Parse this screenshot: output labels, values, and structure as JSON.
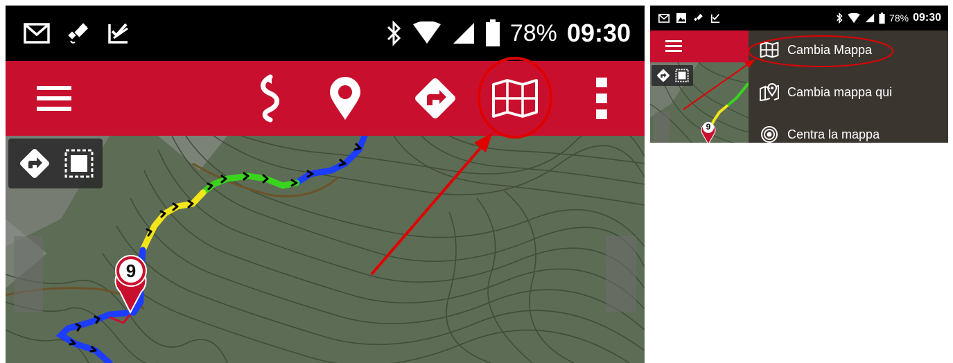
{
  "left_screen": {
    "status_bar": {
      "icons_left": [
        "gmail-icon",
        "satellite-icon",
        "checklist-icon"
      ],
      "icons_right": [
        "bluetooth-icon",
        "wifi-icon",
        "signal-icon",
        "battery-icon"
      ],
      "battery": "78%",
      "time": "09:30"
    },
    "toolbar": {
      "buttons": [
        "menu-icon",
        "route-icon",
        "waypoint-icon",
        "navigate-icon",
        "map-icon",
        "overflow-menu-icon"
      ],
      "accent_color": "#c8102e"
    },
    "map": {
      "marker_label": "9",
      "controls": [
        "navigate-icon",
        "select-area-icon"
      ]
    },
    "annotation": {
      "highlight": "map-icon",
      "arrow_color": "#e00000"
    }
  },
  "right_screen": {
    "status_bar": {
      "icons_left": [
        "gmail-icon",
        "image-icon",
        "satellite-icon",
        "checklist-icon"
      ],
      "battery": "78%",
      "time": "09:30"
    },
    "map": {
      "marker_label": "9"
    },
    "menu": {
      "items": [
        {
          "label": "Cambia Mappa",
          "icon": "map-icon"
        },
        {
          "label": "Cambia mappa qui",
          "icon": "map-pin-icon"
        },
        {
          "label": "Centra la mappa",
          "icon": "target-icon"
        }
      ],
      "background": "#3b3530"
    }
  }
}
